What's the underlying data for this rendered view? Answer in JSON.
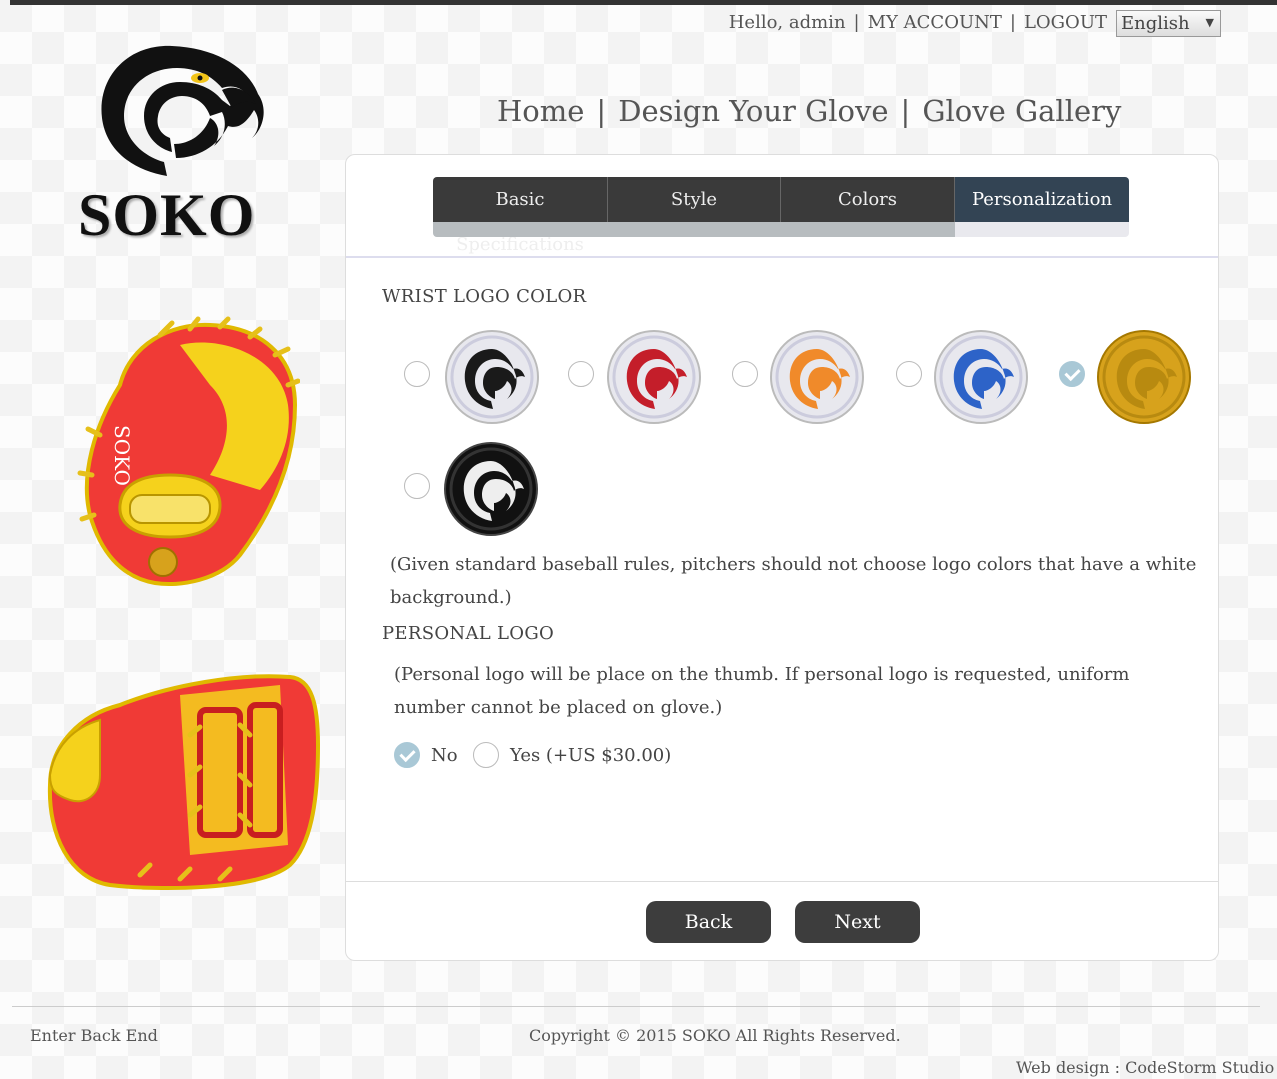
{
  "header": {
    "greeting": "Hello, admin",
    "my_account": "MY ACCOUNT",
    "logout": "LOGOUT",
    "language": "English",
    "separator": "|"
  },
  "brand": {
    "name": "SOKO"
  },
  "nav": {
    "home": "Home",
    "design": "Design Your Glove",
    "gallery": "Glove Gallery",
    "separator": "|"
  },
  "steps": {
    "items": [
      "Basic Specifications",
      "Style",
      "Colors",
      "Personalization"
    ],
    "active": "Personalization",
    "progress": 0.75
  },
  "wrist_logo": {
    "title": "WRIST LOGO COLOR",
    "options": [
      {
        "name": "black",
        "color": "#1a1a1a",
        "selected": false
      },
      {
        "name": "red",
        "color": "#c41e2a",
        "selected": false
      },
      {
        "name": "orange",
        "color": "#f08a2a",
        "selected": false
      },
      {
        "name": "blue",
        "color": "#2d63c8",
        "selected": false
      },
      {
        "name": "gold",
        "color": "#d7a21c",
        "selected": true
      },
      {
        "name": "black-background",
        "color": "#111111",
        "selected": false
      }
    ],
    "note": "(Given standard baseball rules, pitchers should not choose logo colors that have a white background.)"
  },
  "personal_logo": {
    "title": "PERSONAL LOGO",
    "note": "(Personal logo will be place on the thumb. If personal logo is requested, uniform number cannot be placed on glove.)",
    "no_label": "No",
    "yes_label": "Yes (+US $30.00)",
    "selected": "No"
  },
  "buttons": {
    "back": "Back",
    "next": "Next"
  },
  "footer": {
    "backend": "Enter Back End",
    "copyright": "Copyright © 2015 SOKO All Rights Reserved.",
    "credit": "Web design : CodeStorm Studio"
  },
  "colors": {
    "step_active": "#334454",
    "step": "#3a3a3a",
    "glove_red": "#f03a36",
    "glove_yellow": "#f5d21c",
    "check": "#a9c8d6"
  }
}
